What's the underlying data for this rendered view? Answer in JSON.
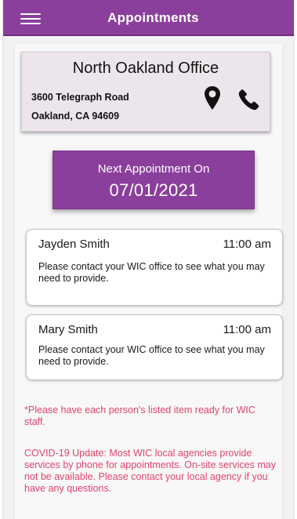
{
  "header": {
    "title": "Appointments",
    "menu_icon": "hamburger-menu-icon",
    "bg_color": "#8b3f9c"
  },
  "office": {
    "name": "North Oakland Office",
    "address_line1": "3600 Telegraph Road",
    "address_line2": "Oakland, CA 94609",
    "location_icon": "map-pin-icon",
    "phone_icon": "phone-icon"
  },
  "next_appointment": {
    "label": "Next Appointment On",
    "date": "07/01/2021"
  },
  "appointments": [
    {
      "name": "Jayden Smith",
      "time": "11:00 am",
      "note": "Please contact your WIC office to see what you may need to provide."
    },
    {
      "name": "Mary Smith",
      "time": "11:00 am",
      "note": "Please contact your WIC office to see what you may need to provide."
    }
  ],
  "notices": [
    "*Please have each person's listed item ready for WIC staff.",
    "COVID-19 Update: Most WIC local agencies provide services by phone for appointments. On-site services may not be available. Please contact your local agency if you have any questions."
  ],
  "colors": {
    "accent": "#8b3f9c",
    "notice_text": "#e0446a"
  }
}
